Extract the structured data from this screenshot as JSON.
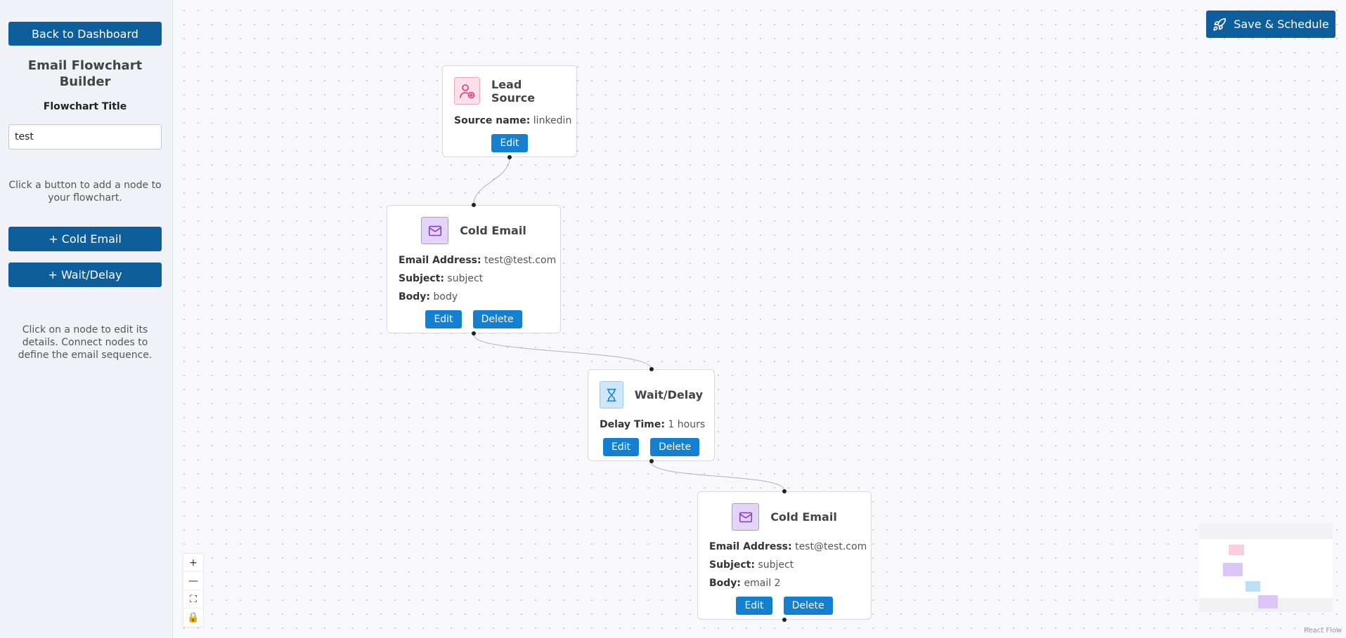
{
  "sidebar": {
    "back_label": "Back to Dashboard",
    "title": "Email Flowchart Builder",
    "flowchart_title_label": "Flowchart Title",
    "flowchart_title_value": "test",
    "help_add": "Click a button to add a node to your flowchart.",
    "add_cold_email_label": "+ Cold Email",
    "add_wait_label": "+ Wait/Delay",
    "help_edit": "Click on a node to edit its details. Connect nodes to define the email sequence."
  },
  "toolbar": {
    "save_label": "Save & Schedule"
  },
  "nodes": {
    "lead": {
      "title": "Lead Source",
      "source_label": "Source name:",
      "source_value": "linkedin",
      "edit_label": "Edit"
    },
    "cold1": {
      "title": "Cold Email",
      "email_label": "Email Address:",
      "email_value": "test@test.com",
      "subject_label": "Subject:",
      "subject_value": "subject",
      "body_label": "Body:",
      "body_value": "body",
      "edit_label": "Edit",
      "delete_label": "Delete"
    },
    "wait": {
      "title": "Wait/Delay",
      "delay_label": "Delay Time:",
      "delay_value": "1 hours",
      "edit_label": "Edit",
      "delete_label": "Delete"
    },
    "cold2": {
      "title": "Cold Email",
      "email_label": "Email Address:",
      "email_value": "test@test.com",
      "subject_label": "Subject:",
      "subject_value": "subject",
      "body_label": "Body:",
      "body_value": "email 2",
      "edit_label": "Edit",
      "delete_label": "Delete"
    }
  },
  "controls": {
    "zoom_in": "+",
    "zoom_out": "—",
    "fit": "⛶",
    "lock": "🔒"
  },
  "colors": {
    "primary": "#0f5e9c",
    "button": "#1580d0",
    "lead": "#fbe0ea",
    "email": "#e4d4f7",
    "wait": "#cfe6f8"
  },
  "attribution": "React Flow"
}
